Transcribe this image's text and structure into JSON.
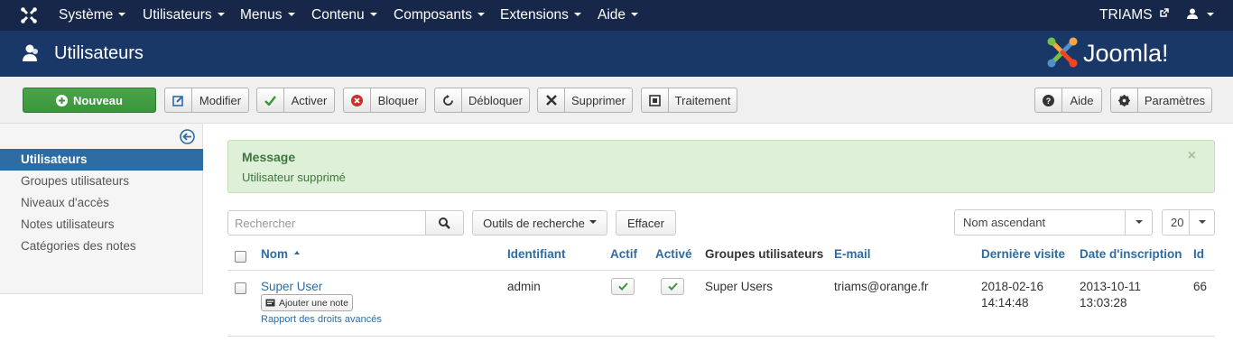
{
  "topnav": {
    "menus": [
      "Système",
      "Utilisateurs",
      "Menus",
      "Contenu",
      "Composants",
      "Extensions",
      "Aide"
    ],
    "site_link": "TRIAMS"
  },
  "header": {
    "title": "Utilisateurs",
    "logo_text": "Joomla!"
  },
  "toolbar": {
    "new": "Nouveau",
    "edit": "Modifier",
    "activate": "Activer",
    "block": "Bloquer",
    "unblock": "Débloquer",
    "delete": "Supprimer",
    "batch": "Traitement",
    "help": "Aide",
    "options": "Paramètres"
  },
  "sidebar": {
    "items": [
      {
        "label": "Utilisateurs",
        "active": true
      },
      {
        "label": "Groupes utilisateurs",
        "active": false
      },
      {
        "label": "Niveaux d'accès",
        "active": false
      },
      {
        "label": "Notes utilisateurs",
        "active": false
      },
      {
        "label": "Catégories des notes",
        "active": false
      }
    ]
  },
  "alert": {
    "heading": "Message",
    "text": "Utilisateur supprimé",
    "close": "×"
  },
  "filters": {
    "search_placeholder": "Rechercher",
    "search_tools": "Outils de recherche",
    "clear": "Effacer",
    "ordering": "Nom ascendant",
    "limit": "20"
  },
  "table": {
    "headers": {
      "name": "Nom",
      "username": "Identifiant",
      "enabled": "Actif",
      "activated": "Activé",
      "groups": "Groupes utilisateurs",
      "email": "E-mail",
      "last_visit": "Dernière visite",
      "registered": "Date d'inscription",
      "id": "Id"
    },
    "rows": [
      {
        "name": "Super User",
        "add_note": "Ajouter une note",
        "debug": "Rapport des droits avancés",
        "username": "admin",
        "groups": "Super Users",
        "email": "triams@orange.fr",
        "last_visit_date": "2018-02-16",
        "last_visit_time": "14:14:48",
        "registered_date": "2013-10-11",
        "registered_time": "13:03:28",
        "id": "66"
      }
    ]
  },
  "colors": {
    "topnav_bg": "#17274a",
    "header_bg": "#1a3867",
    "new_button": "#3a963a",
    "sidebar_active": "#2d6ca2",
    "link": "#2d6ca2",
    "alert_bg": "#dff0d8"
  },
  "icons": [
    "joomla-icon",
    "user-icon",
    "external-link-icon",
    "plus-circle-icon",
    "edit-icon",
    "check-icon",
    "block-icon",
    "unblock-icon",
    "close-icon",
    "batch-icon",
    "help-icon",
    "gear-icon",
    "back-arrow-icon",
    "search-icon",
    "note-icon"
  ]
}
